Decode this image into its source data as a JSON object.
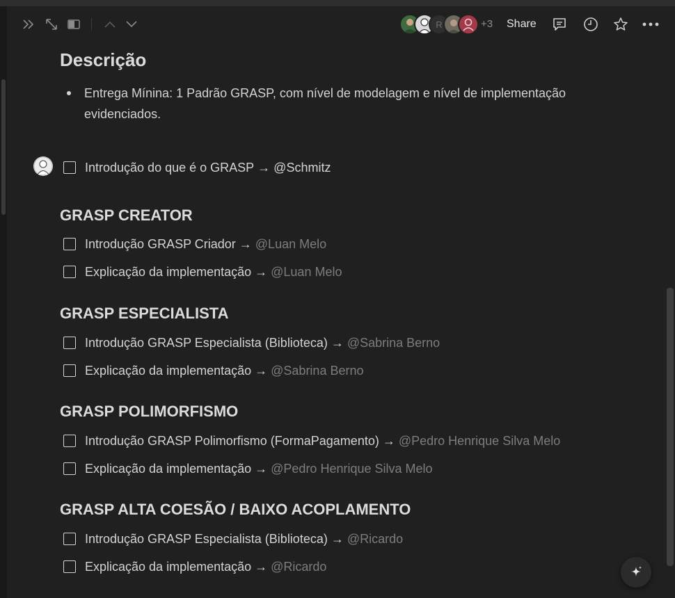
{
  "toolbar": {
    "icons": [
      "double-chevron-right-icon",
      "expand-diagonal-icon",
      "side-peek-icon",
      "chevron-up-icon",
      "chevron-down-icon"
    ],
    "extra_collaborators": "+3",
    "share_label": "Share",
    "right_icons": [
      "comment-icon",
      "clock-icon",
      "star-icon",
      "more-icon"
    ],
    "avatar_colors": [
      "#3e6b3e",
      "#d8d8d8",
      "#2f2f2f",
      "#6f6a60",
      "#a33a4a"
    ],
    "avatar_letter": "R"
  },
  "description": {
    "heading": "Descrição",
    "bullet": "Entrega Mínina: 1 Padrão GRASP, com nível de modelagem e nível de implementação evidenciados."
  },
  "intro_task": {
    "text": "Introdução do que é o GRASP",
    "arrow": "→",
    "mention": "@Schmitz"
  },
  "sections": [
    {
      "title": "GRASP CREATOR",
      "tasks": [
        {
          "text": "Introdução GRASP Criador",
          "arrow": "→",
          "mention": "@Luan Melo"
        },
        {
          "text": "Explicação da implementação",
          "arrow": "→",
          "mention": "@Luan Melo"
        }
      ]
    },
    {
      "title": "GRASP ESPECIALISTA",
      "tasks": [
        {
          "text": "Introdução GRASP Especialista (Biblioteca)",
          "arrow": "→",
          "mention": "@Sabrina Berno"
        },
        {
          "text": "Explicação da implementação",
          "arrow": "→",
          "mention": "@Sabrina Berno"
        }
      ]
    },
    {
      "title": "GRASP POLIMORFISMO",
      "tasks": [
        {
          "text": "Introdução GRASP Polimorfismo (FormaPagamento)",
          "arrow": "→",
          "mention": "@Pedro Henrique Silva Melo"
        },
        {
          "text": "Explicação da implementação",
          "arrow": "→",
          "mention": "@Pedro Henrique Silva Melo"
        }
      ]
    },
    {
      "title": "GRASP ALTA COESÃO / BAIXO ACOPLAMENTO",
      "tasks": [
        {
          "text": "Introdução GRASP Especialista (Biblioteca)",
          "arrow": "→",
          "mention": "@Ricardo"
        },
        {
          "text": "Explicação da implementação",
          "arrow": "→",
          "mention": "@Ricardo"
        }
      ]
    }
  ],
  "colors": {
    "background": "#202020",
    "text": "#d4d4d4",
    "muted_mention": "#7d7d7d"
  }
}
